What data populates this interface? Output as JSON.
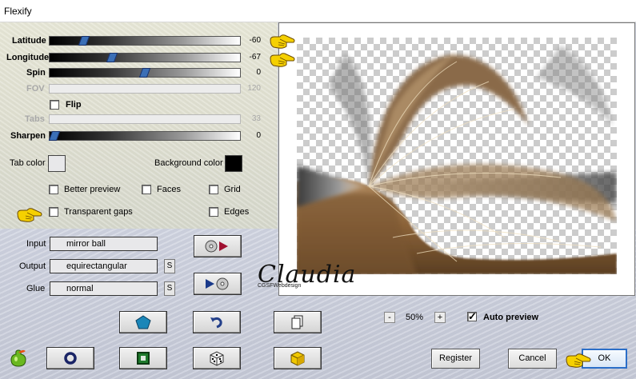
{
  "window": {
    "title": "Flexify"
  },
  "sliders": [
    {
      "label": "Latitude",
      "value": "-60",
      "enabled": true,
      "level": 0.17
    },
    {
      "label": "Longitude",
      "value": "-67",
      "enabled": true,
      "level": 0.31
    },
    {
      "label": "Spin",
      "value": "0",
      "enabled": true,
      "level": 0.5
    },
    {
      "label": "FOV",
      "value": "120",
      "enabled": false,
      "level": 0
    },
    {
      "label": "Tabs",
      "value": "33",
      "enabled": false,
      "level": 0
    },
    {
      "label": "Sharpen",
      "value": "0",
      "enabled": true,
      "level": 0
    }
  ],
  "flip": {
    "label": "Flip",
    "checked": false
  },
  "colors": {
    "tab_label": "Tab color",
    "tab_value": "#e8e8ea",
    "background_label": "Background color",
    "background_value": "#000000"
  },
  "options": {
    "better_preview": {
      "label": "Better preview",
      "checked": false
    },
    "faces": {
      "label": "Faces",
      "checked": false
    },
    "grid": {
      "label": "Grid",
      "checked": false
    },
    "transparent_gaps": {
      "label": "Transparent gaps",
      "checked": false
    },
    "edges": {
      "label": "Edges",
      "checked": false
    }
  },
  "projection": {
    "input_label": "Input",
    "input_value": "mirror ball",
    "output_label": "Output",
    "output_value": "equirectangular",
    "glue_label": "Glue",
    "glue_value": "normal",
    "swap_label": "S"
  },
  "preview": {
    "zoom_minus": "-",
    "zoom": "50%",
    "zoom_plus": "+",
    "auto_preview_label": "Auto preview",
    "auto_preview": true
  },
  "watermark": {
    "name": "Claudia",
    "credit": "CGSFWebdesign"
  },
  "buttons": {
    "register": "Register",
    "cancel": "Cancel",
    "ok": "OK"
  },
  "accent": {
    "ok_border": "#2b6ec8",
    "slider_thumb": "#3b6fb6"
  }
}
